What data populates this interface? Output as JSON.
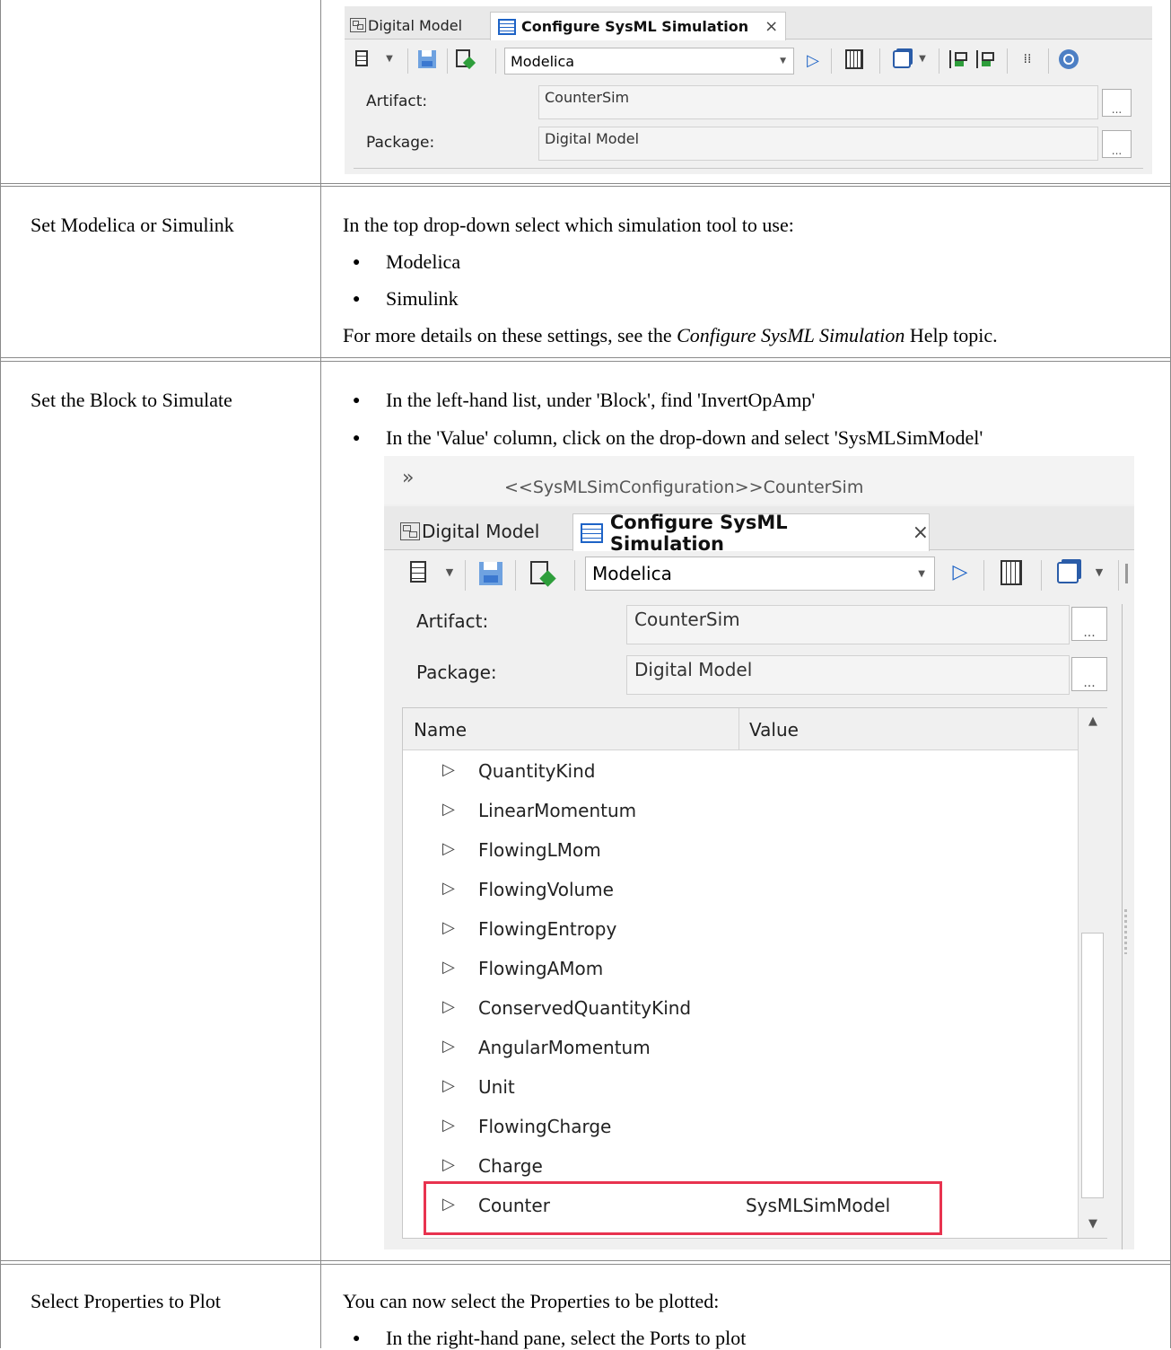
{
  "table": {
    "rows": [
      {
        "step": ""
      },
      {
        "step": "Set Modelica or Simulink",
        "intro": "In the top drop-down select which simulation tool to use:",
        "bullets": [
          "Modelica",
          "Simulink"
        ],
        "note_pre": "For more details on these settings, see the ",
        "note_italic": "Configure SysML Simulation",
        "note_post": " Help topic."
      },
      {
        "step": "Set the Block to Simulate",
        "bullets": [
          "In the left-hand list, under 'Block', find 'InvertOpAmp'",
          "In the 'Value' column, click on the drop-down and select 'SysMLSimModel'"
        ]
      },
      {
        "step": "Select Properties to Plot",
        "intro": "You can now select the Properties to be plotted:",
        "bullets": [
          "In the right-hand pane, select the Ports to plot"
        ]
      }
    ]
  },
  "panel_small": {
    "tab_model": "Digital Model",
    "tab_config": "Configure SysML Simulation",
    "tab_close": "×",
    "tool_select": "Modelica",
    "artifact_label": "Artifact:",
    "artifact_value": "CounterSim",
    "package_label": "Package:",
    "package_value": "Digital Model",
    "ellipsis": "..."
  },
  "panel_large": {
    "breadcrumb_icon": "»",
    "breadcrumb": "<<SysMLSimConfiguration>>CounterSim",
    "tab_model": "Digital Model",
    "tab_config": "Configure SysML Simulation",
    "tab_close": "×",
    "tool_select": "Modelica",
    "artifact_label": "Artifact:",
    "artifact_value": "CounterSim",
    "package_label": "Package:",
    "package_value": "Digital Model",
    "ellipsis": "...",
    "col_name": "Name",
    "col_value": "Value",
    "items": [
      {
        "name": "QuantityKind",
        "value": ""
      },
      {
        "name": "LinearMomentum",
        "value": ""
      },
      {
        "name": "FlowingLMom",
        "value": ""
      },
      {
        "name": "FlowingVolume",
        "value": ""
      },
      {
        "name": "FlowingEntropy",
        "value": ""
      },
      {
        "name": "FlowingAMom",
        "value": ""
      },
      {
        "name": "ConservedQuantityKind",
        "value": ""
      },
      {
        "name": "AngularMomentum",
        "value": ""
      },
      {
        "name": "Unit",
        "value": ""
      },
      {
        "name": "FlowingCharge",
        "value": ""
      },
      {
        "name": "Charge",
        "value": ""
      },
      {
        "name": "Counter",
        "value": "SysMLSimModel"
      }
    ],
    "highlight_color": "#e8334f"
  },
  "colors": {
    "accent_blue": "#1e63c6",
    "border": "#8a8a8a"
  }
}
